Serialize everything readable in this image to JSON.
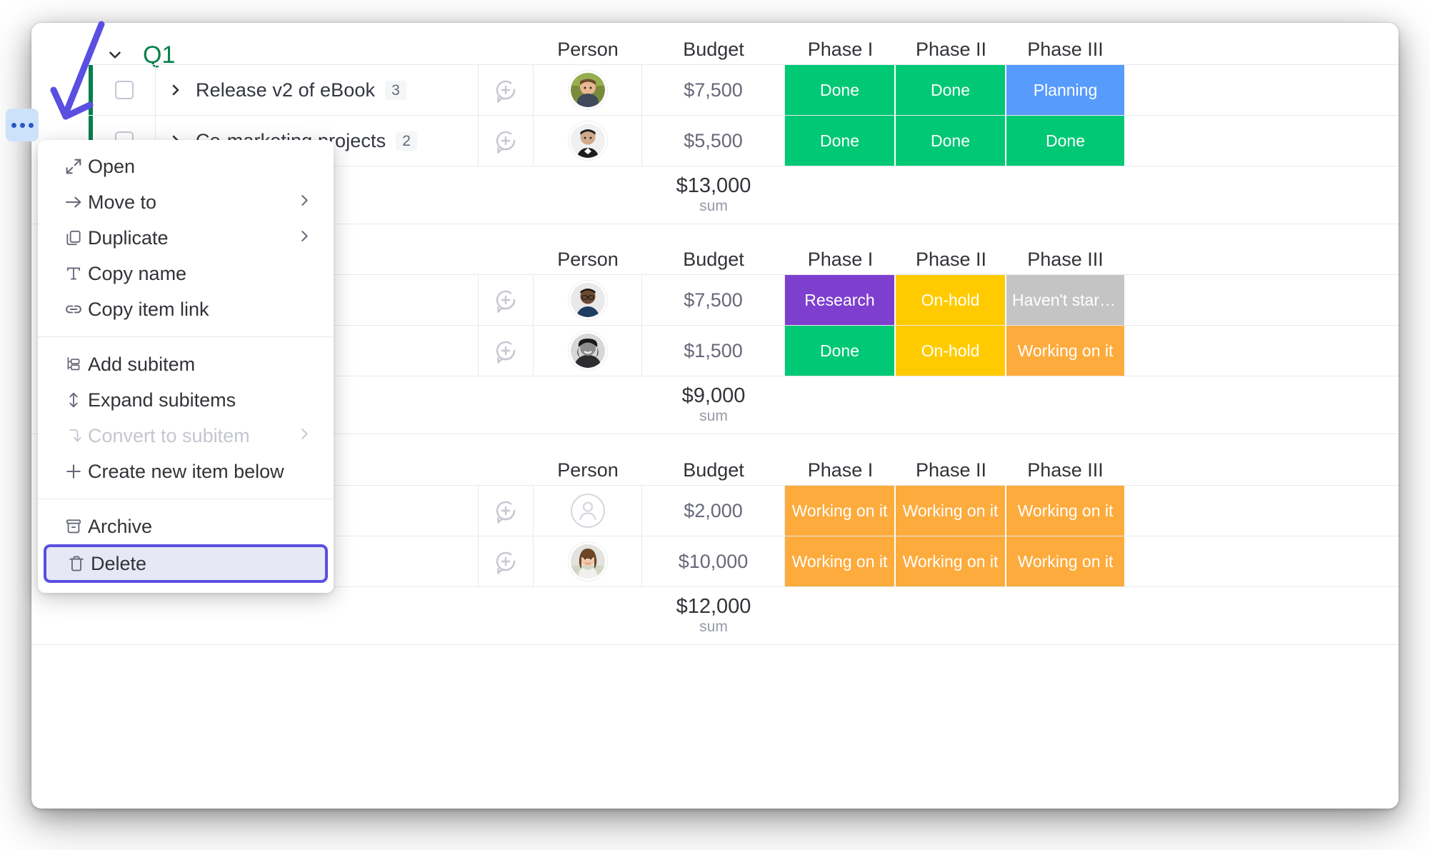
{
  "board": {
    "title": "Q1"
  },
  "columns": {
    "person": "Person",
    "budget": "Budget",
    "phase1": "Phase I",
    "phase2": "Phase II",
    "phase3": "Phase III"
  },
  "groups": [
    {
      "title": "Q1",
      "color": "#037f4c",
      "sum": "$13,000",
      "sum_label": "sum",
      "rows": [
        {
          "name": "Release v2 of eBook",
          "subcount": "3",
          "budget": "$7,500",
          "p1": "Done",
          "p2": "Done",
          "p3": "Planning"
        },
        {
          "name": "Co-marketing projects",
          "subcount": "2",
          "budget": "$5,500",
          "p1": "Done",
          "p2": "Done",
          "p3": "Done"
        }
      ]
    },
    {
      "title": "",
      "color": "#a25ddc",
      "sum": "$9,000",
      "sum_label": "sum",
      "rows": [
        {
          "name": "",
          "subcount": "",
          "budget": "$7,500",
          "p1": "Research",
          "p2": "On-hold",
          "p3": "Haven't started..."
        },
        {
          "name": "",
          "subcount": "",
          "budget": "$1,500",
          "p1": "Done",
          "p2": "On-hold",
          "p3": "Working on it"
        }
      ]
    },
    {
      "title": "",
      "color": "#fdab3d",
      "sum": "$12,000",
      "sum_label": "sum",
      "rows": [
        {
          "name": "",
          "subcount": "",
          "budget": "$2,000",
          "p1": "Working on it",
          "p2": "Working on it",
          "p3": "Working on it"
        },
        {
          "name": "",
          "subcount": "",
          "budget": "$10,000",
          "p1": "Working on it",
          "p2": "Working on it",
          "p3": "Working on it"
        }
      ]
    }
  ],
  "menu": {
    "items": [
      {
        "label": "Open",
        "icon": "open-expand-icon",
        "disabled": false,
        "submenu": false
      },
      {
        "label": "Move to",
        "icon": "arrow-right-icon",
        "disabled": false,
        "submenu": true
      },
      {
        "label": "Duplicate",
        "icon": "duplicate-icon",
        "disabled": false,
        "submenu": true
      },
      {
        "label": "Copy name",
        "icon": "text-icon",
        "disabled": false,
        "submenu": false
      },
      {
        "label": "Copy item link",
        "icon": "link-icon",
        "disabled": false,
        "submenu": false
      },
      {
        "label": "Add subitem",
        "icon": "subitem-tree-icon",
        "disabled": false,
        "submenu": false
      },
      {
        "label": "Expand subitems",
        "icon": "expand-vertical-icon",
        "disabled": false,
        "submenu": false
      },
      {
        "label": "Convert to subitem",
        "icon": "convert-arrow-icon",
        "disabled": true,
        "submenu": true
      },
      {
        "label": "Create new item below",
        "icon": "plus-icon",
        "disabled": false,
        "submenu": false
      },
      {
        "label": "Archive",
        "icon": "archive-icon",
        "disabled": false,
        "submenu": false
      },
      {
        "label": "Delete",
        "icon": "trash-icon",
        "disabled": false,
        "submenu": false
      }
    ],
    "selected_item": "Delete"
  },
  "status_colors": {
    "done": "#00c875",
    "planning": "#579bfc",
    "research": "#7e3ece",
    "on_hold": "#ffcb00",
    "havent_started": "#c4c4c4",
    "working_on_it": "#fdab3d"
  },
  "accent": {
    "annotation_arrow": "#5a4fe0",
    "menu_selection_border": "#5a4fe0",
    "menu_selection_fill": "#e6e9f5",
    "dots_button_bg": "#cce2fb",
    "dots_button_dot": "#2b56c6",
    "group_q1": "#037f4c"
  }
}
